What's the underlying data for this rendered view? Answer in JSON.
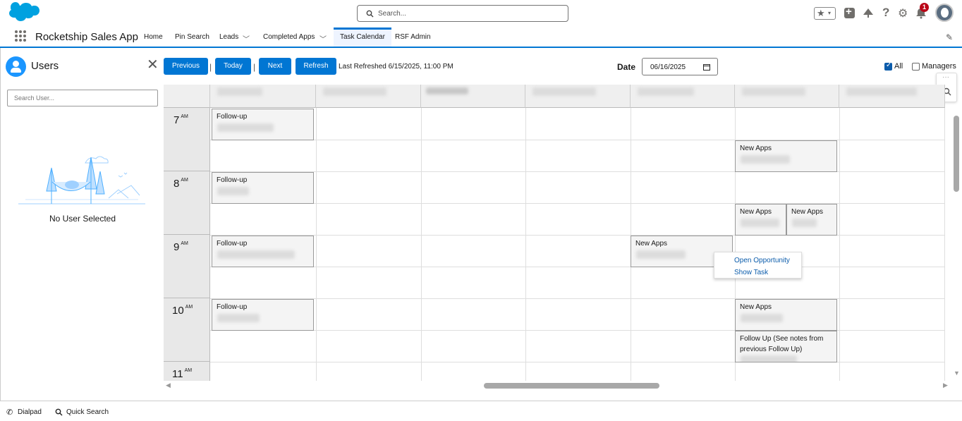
{
  "header": {
    "search_placeholder": "Search...",
    "notification_count": "1"
  },
  "nav": {
    "app_name": "Rocketship Sales App",
    "items": [
      {
        "label": "Home"
      },
      {
        "label": "Pin Search"
      },
      {
        "label": "Leads"
      },
      {
        "label": "Completed Apps"
      },
      {
        "label": "Task Calendar"
      },
      {
        "label": "RSF Admin"
      }
    ]
  },
  "users_panel": {
    "title": "Users",
    "search_placeholder": "Search User...",
    "empty_text": "No User Selected"
  },
  "toolbar": {
    "previous": "Previous",
    "today": "Today",
    "next": "Next",
    "refresh": "Refresh",
    "separator": "|",
    "last_refreshed": "Last Refreshed 6/15/2025, 11:00 PM",
    "date_label": "Date",
    "date_value": "06/16/2025",
    "all_label": "All",
    "managers_label": "Managers"
  },
  "calendar": {
    "hours": [
      {
        "hour": "7",
        "period": "AM"
      },
      {
        "hour": "8",
        "period": "AM"
      },
      {
        "hour": "9",
        "period": "AM"
      },
      {
        "hour": "10",
        "period": "AM"
      },
      {
        "hour": "11",
        "period": "AM"
      }
    ],
    "events": [
      {
        "title": "Follow-up"
      },
      {
        "title": "Follow-up"
      },
      {
        "title": "Follow-up"
      },
      {
        "title": "Follow-up"
      },
      {
        "title": "New Apps"
      },
      {
        "title": "New Apps"
      },
      {
        "title": "New Apps"
      },
      {
        "title": "New Apps"
      },
      {
        "title": "New Apps"
      },
      {
        "title": "Follow Up (See notes from previous Follow Up)"
      }
    ]
  },
  "context_menu": {
    "open_opportunity": "Open Opportunity",
    "show_task": "Show Task"
  },
  "utility_bar": {
    "dialpad": "Dialpad",
    "quick_search": "Quick Search"
  },
  "colors": {
    "brand": "#0176d3",
    "link": "#0b5cab",
    "notification": "#ba0517"
  }
}
